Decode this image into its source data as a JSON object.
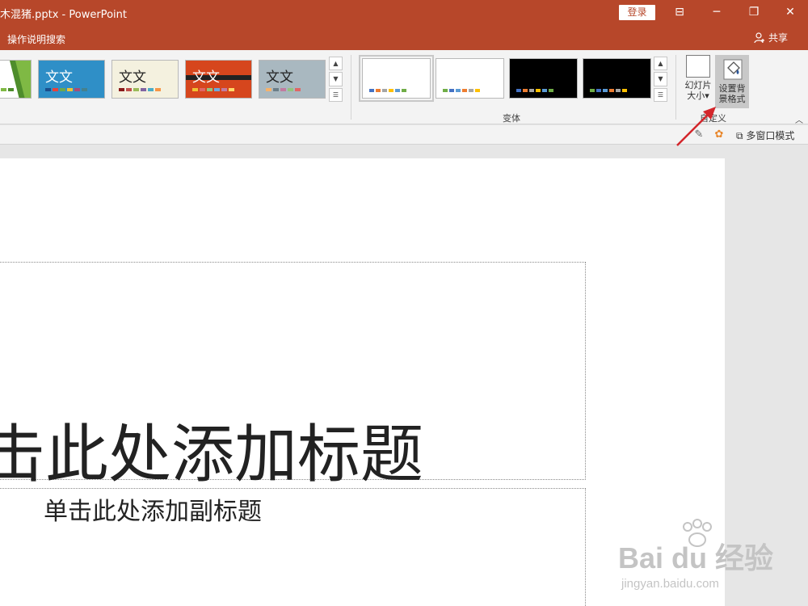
{
  "window": {
    "title": "木混猪.pptx  -  PowerPoint",
    "login_label": "登录",
    "minimize": "─",
    "restore": "❐",
    "close": "✕",
    "ribbon_options": "⊟"
  },
  "tellbar": {
    "search_label": "操作说明搜索",
    "share_label": "共享"
  },
  "ribbon": {
    "themes": [
      {
        "text": "",
        "bg": "#ffffff",
        "accent": "#7fb944"
      },
      {
        "text": "文文",
        "bg": "#2f8fc7",
        "accent": "#1c6fa8"
      },
      {
        "text": "文文",
        "bg": "#f4f1df",
        "accent": "#8a1a1a"
      },
      {
        "text": "文文",
        "bg": "#d6461d",
        "accent": "#222222"
      },
      {
        "text": "文文",
        "bg": "#a9b8c0",
        "accent": "#6b7e88"
      }
    ],
    "variants_label": "变体",
    "variants": [
      {
        "bg": "#ffffff",
        "selected": true
      },
      {
        "bg": "#ffffff",
        "selected": false
      },
      {
        "bg": "#000000",
        "selected": false
      },
      {
        "bg": "#000000",
        "selected": false
      }
    ],
    "slide_size_label": "幻灯片大小",
    "slide_size_caret": "▾",
    "format_bg_label": "设置背景格式",
    "customize_label": "自定义",
    "scroll_up": "▲",
    "scroll_down": "▼",
    "scroll_more": "☰",
    "collapse": "︿"
  },
  "subbar": {
    "multiwindow_label": "多窗口模式"
  },
  "slide": {
    "title_placeholder": "击此处添加标题",
    "subtitle_placeholder": "单击此处添加副标题"
  },
  "watermark": {
    "main": "Bai du 经验",
    "sub": "jingyan.baidu.com"
  },
  "colors": {
    "accent": "#b7472a",
    "annotation": "#d3262b"
  }
}
